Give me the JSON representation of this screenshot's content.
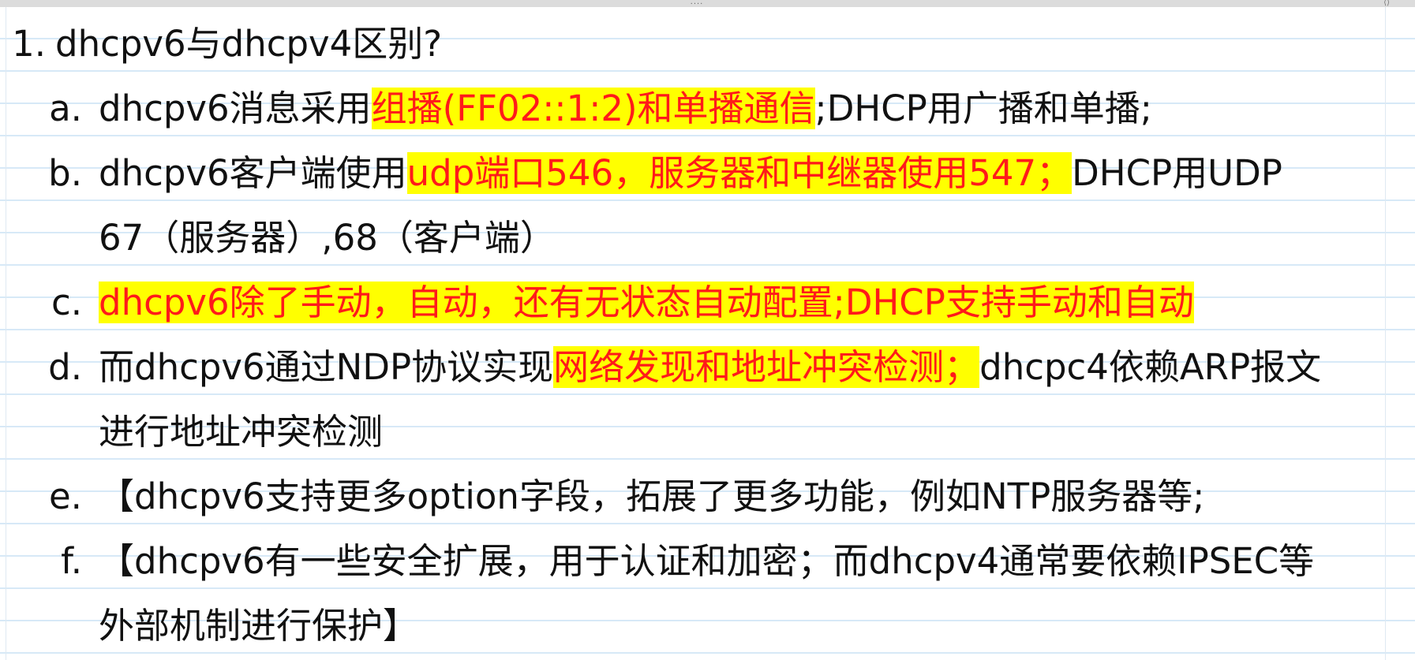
{
  "toolbar": {
    "handle": "....",
    "corner": "⟨⟩"
  },
  "heading": {
    "number": "1.",
    "text": "dhcpv6与dhcpv4区别?"
  },
  "items": {
    "a": {
      "marker": "a.",
      "before": "dhcpv6消息采用",
      "highlight": "组播(FF02::1:2)和单播通信",
      "after": ";DHCP用广播和单播;"
    },
    "b": {
      "marker": "b.",
      "before": "dhcpv6客户端使用",
      "highlight": "udp端口546，服务器和中继器使用547；",
      "after": "DHCP用UDP",
      "line2": "67（服务器）,68（客户端）"
    },
    "c": {
      "marker": "c.",
      "highlight": "dhcpv6除了手动，自动，还有无状态自动配置;DHCP支持手动和自动"
    },
    "d": {
      "marker": "d.",
      "before": "而dhcpv6通过NDP协议实现",
      "highlight": "网络发现和地址冲突检测；",
      "after": "dhcpc4依赖ARP报文",
      "line2": "进行地址冲突检测"
    },
    "e": {
      "marker": "e.",
      "text": "【dhcpv6支持更多option字段，拓展了更多功能，例如NTP服务器等;"
    },
    "f": {
      "marker": "f.",
      "text": "【dhcpv6有一些安全扩展，用于认证和加密；而dhcpv4通常要依赖IPSEC等",
      "line2": "外部机制进行保护】"
    }
  },
  "colors": {
    "highlight_bg": "#ffff00",
    "highlight_text": "#ff1a1a",
    "rule_line": "#d7e9f7"
  }
}
